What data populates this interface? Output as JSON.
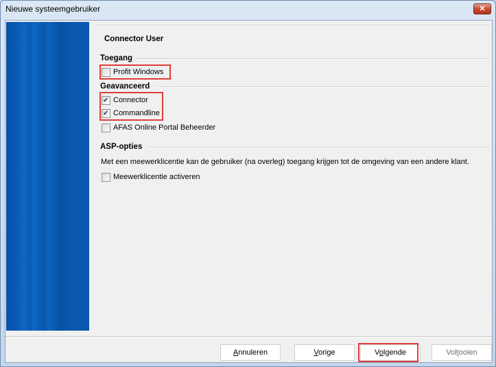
{
  "window": {
    "title": "Nieuwe systeemgebruiker",
    "close_label": "✕"
  },
  "page": {
    "title": "Connector User"
  },
  "sections": {
    "toegang": {
      "title": "Toegang",
      "items": [
        {
          "label": "Profit Windows",
          "checked": false
        }
      ]
    },
    "geavanceerd": {
      "title": "Geavanceerd",
      "items": [
        {
          "label": "Connector",
          "checked": true
        },
        {
          "label": "Commandline",
          "checked": true
        },
        {
          "label": "AFAS Online Portal Beheerder",
          "checked": false
        }
      ]
    },
    "asp": {
      "title": "ASP-opties",
      "description": "Met een meewerklicentie kan de gebruiker (na overleg) toegang krijgen tot de omgeving van een andere klant.",
      "items": [
        {
          "label": "Meewerklicentie activeren",
          "checked": false
        }
      ]
    }
  },
  "buttons": {
    "cancel": {
      "mnemonic": "A",
      "rest": "nnuleren"
    },
    "previous": {
      "mnemonic": "V",
      "rest": "orige"
    },
    "next": {
      "prefix": "V",
      "mnemonic": "o",
      "rest": "lgende"
    },
    "finish": {
      "prefix": "Vol",
      "mnemonic": "t",
      "rest": "ooien"
    }
  },
  "highlight_color": "#e03c3c"
}
